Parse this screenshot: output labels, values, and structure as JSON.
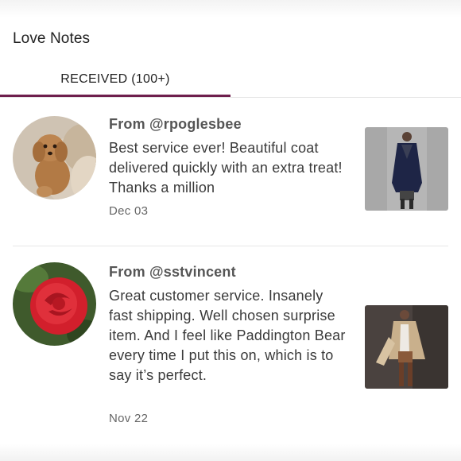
{
  "header": {
    "title": "Love Notes"
  },
  "tabs": [
    {
      "label": "RECEIVED (100+)",
      "active": true
    }
  ],
  "accent_color": "#6e1f4d",
  "notes": [
    {
      "from": "From @rpoglesbee",
      "message": "Best service ever! Beautiful coat delivered quickly with an extra treat! Thanks a million",
      "date": "Dec 03",
      "avatar": "dog-photo",
      "thumbnail": "navy-coat-photo"
    },
    {
      "from": "From @sstvincent",
      "message": "Great customer service. Insanely fast shipping. Well chosen surprise item. And I feel like Paddington Bear every time I put this on, which is to say it’s perfect.",
      "date": "Nov 22",
      "avatar": "red-rose-photo",
      "thumbnail": "tan-coat-photo"
    }
  ]
}
